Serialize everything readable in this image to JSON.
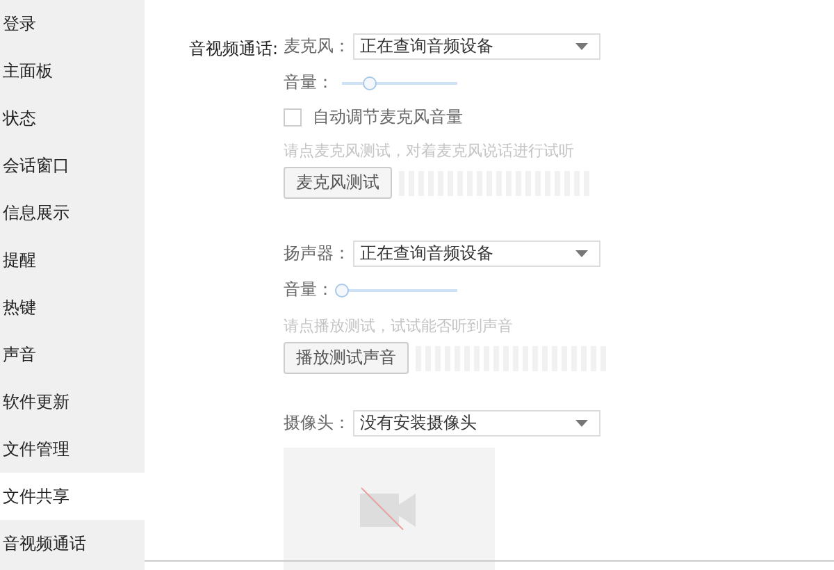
{
  "sidebar": {
    "items": [
      {
        "label": "登录",
        "selected": false
      },
      {
        "label": "主面板",
        "selected": false
      },
      {
        "label": "状态",
        "selected": false
      },
      {
        "label": "会话窗口",
        "selected": false
      },
      {
        "label": "信息展示",
        "selected": false
      },
      {
        "label": "提醒",
        "selected": false
      },
      {
        "label": "热键",
        "selected": false
      },
      {
        "label": "声音",
        "selected": false
      },
      {
        "label": "软件更新",
        "selected": false
      },
      {
        "label": "文件管理",
        "selected": false
      },
      {
        "label": "文件共享",
        "selected": true
      },
      {
        "label": "音视频通话",
        "selected": false
      }
    ]
  },
  "section_label": "音视频通话:",
  "microphone": {
    "label": "麦克风：",
    "device": "正在查询音频设备",
    "volume_label": "音量：",
    "volume": {
      "level": 0.25
    },
    "auto_adjust": {
      "label": "自动调节麦克风音量",
      "checked": false
    },
    "hint": "请点麦克风测试，对着麦克风说话进行试听",
    "test_button": "麦克风测试"
  },
  "speaker": {
    "label": "扬声器：",
    "device": "正在查询音频设备",
    "volume_label": "音量：",
    "volume": {
      "level": 0
    },
    "hint": "请点播放测试，试试能否听到声音",
    "test_button": "播放测试声音"
  },
  "camera": {
    "label": "摄像头：",
    "device": "没有安装摄像头"
  }
}
